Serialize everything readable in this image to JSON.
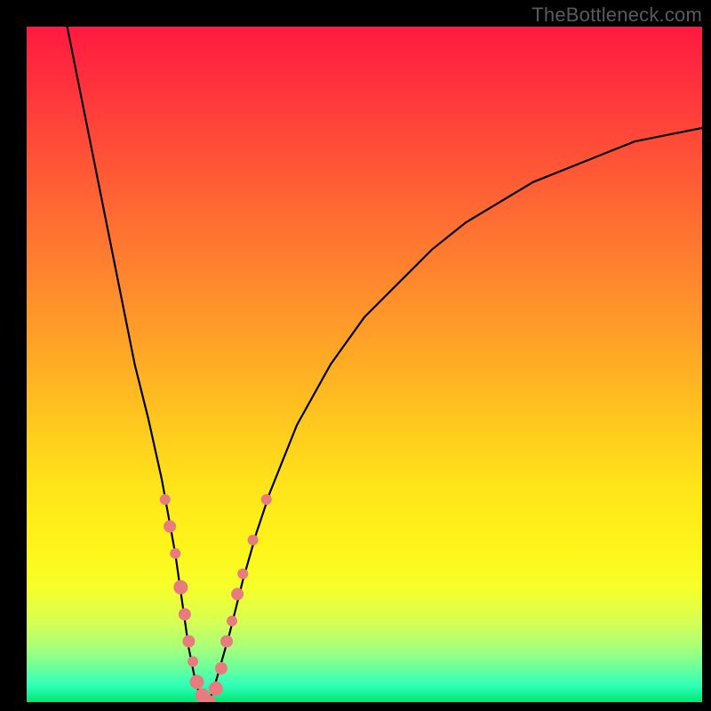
{
  "watermark": "TheBottleneck.com",
  "chart_data": {
    "type": "line",
    "title": "",
    "xlabel": "",
    "ylabel": "",
    "xlim": [
      0,
      100
    ],
    "ylim": [
      0,
      100
    ],
    "series": [
      {
        "name": "bottleneck-curve",
        "x": [
          6,
          8,
          10,
          12,
          14,
          16,
          18,
          20,
          22,
          23,
          24,
          25,
          26,
          27,
          28,
          30,
          32,
          34,
          36,
          40,
          45,
          50,
          55,
          60,
          65,
          70,
          75,
          80,
          85,
          90,
          95,
          100
        ],
        "y": [
          100,
          90,
          80,
          70,
          60,
          50,
          42,
          33,
          22,
          15,
          8,
          3,
          0,
          0,
          3,
          10,
          18,
          25,
          31,
          41,
          50,
          57,
          62,
          67,
          71,
          74,
          77,
          79,
          81,
          83,
          84,
          85
        ]
      }
    ],
    "markers": {
      "name": "highlight-dots",
      "color": "#e77b7d",
      "points": [
        {
          "x": 20.5,
          "y": 30,
          "r": 6
        },
        {
          "x": 21.2,
          "y": 26,
          "r": 7
        },
        {
          "x": 22.0,
          "y": 22,
          "r": 6
        },
        {
          "x": 22.8,
          "y": 17,
          "r": 8
        },
        {
          "x": 23.4,
          "y": 13,
          "r": 7
        },
        {
          "x": 24.0,
          "y": 9,
          "r": 7
        },
        {
          "x": 24.6,
          "y": 6,
          "r": 6
        },
        {
          "x": 25.2,
          "y": 3,
          "r": 8
        },
        {
          "x": 26.0,
          "y": 1,
          "r": 8
        },
        {
          "x": 27.0,
          "y": 0,
          "r": 8
        },
        {
          "x": 28.0,
          "y": 2,
          "r": 8
        },
        {
          "x": 28.8,
          "y": 5,
          "r": 7
        },
        {
          "x": 29.6,
          "y": 9,
          "r": 7
        },
        {
          "x": 30.4,
          "y": 12,
          "r": 6
        },
        {
          "x": 31.2,
          "y": 16,
          "r": 7
        },
        {
          "x": 32.0,
          "y": 19,
          "r": 6
        },
        {
          "x": 33.5,
          "y": 24,
          "r": 6
        },
        {
          "x": 35.5,
          "y": 30,
          "r": 6
        }
      ]
    },
    "gradient_stops": [
      {
        "pos": 0,
        "color": "#ff1a3f"
      },
      {
        "pos": 50,
        "color": "#ffc61f"
      },
      {
        "pos": 80,
        "color": "#fff41a"
      },
      {
        "pos": 100,
        "color": "#00e676"
      }
    ]
  }
}
